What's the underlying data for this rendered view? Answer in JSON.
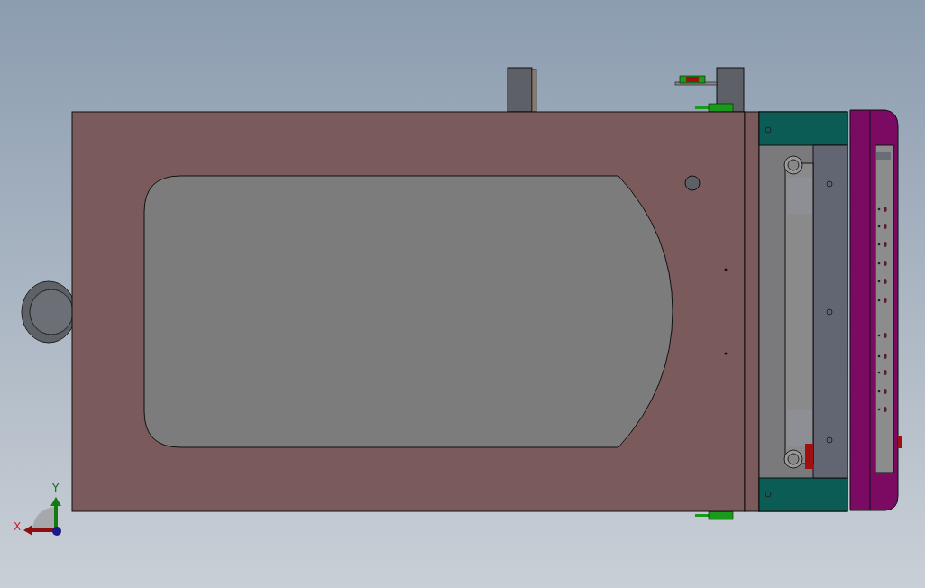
{
  "viewport": {
    "triad": {
      "x_label": "X",
      "y_label": "Y"
    }
  }
}
